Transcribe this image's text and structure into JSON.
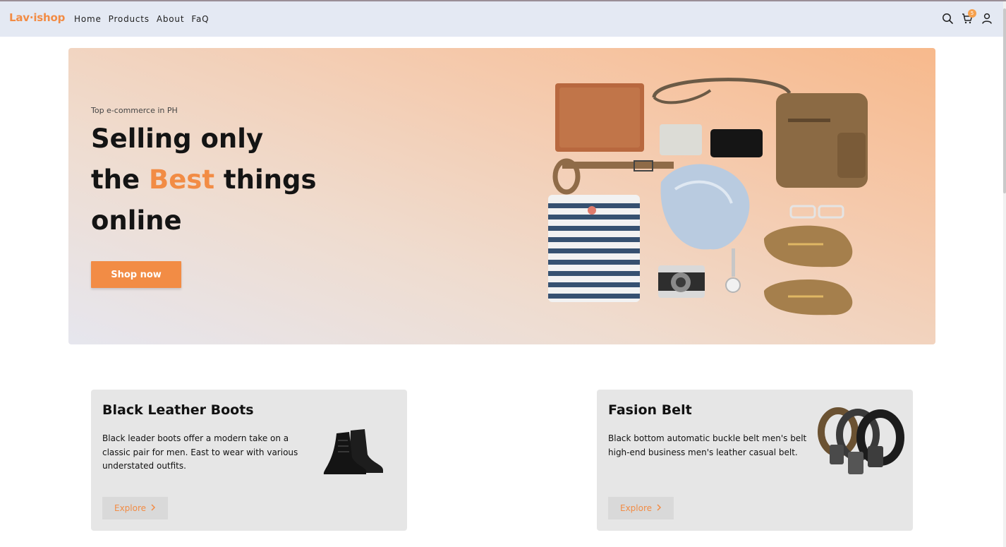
{
  "brand": {
    "name": "Lav·ishop"
  },
  "nav": {
    "links": [
      "Home",
      "Products",
      "About",
      "FaQ"
    ],
    "cart_count": "5",
    "icons": [
      "search-icon",
      "cart-icon",
      "user-icon"
    ]
  },
  "hero": {
    "kicker": "Top e-commerce in PH",
    "title_line1": "Selling only",
    "title_line2_pre": "the ",
    "title_line2_accent": "Best",
    "title_line2_post": " things",
    "title_line3": "online",
    "cta": "Shop now"
  },
  "cards": [
    {
      "title": "Black Leather Boots",
      "description": "Black leader boots offer a modern take on a classic pair for men. East to wear with various understated outfits.",
      "button": "Explore"
    },
    {
      "title": "Fasion Belt",
      "description": "Black bottom automatic buckle belt men's belt high-end business men's leather casual belt.",
      "button": "Explore"
    }
  ],
  "colors": {
    "accent": "#f28c45",
    "navbar": "#e4e9f3",
    "card": "#e6e6e6"
  }
}
